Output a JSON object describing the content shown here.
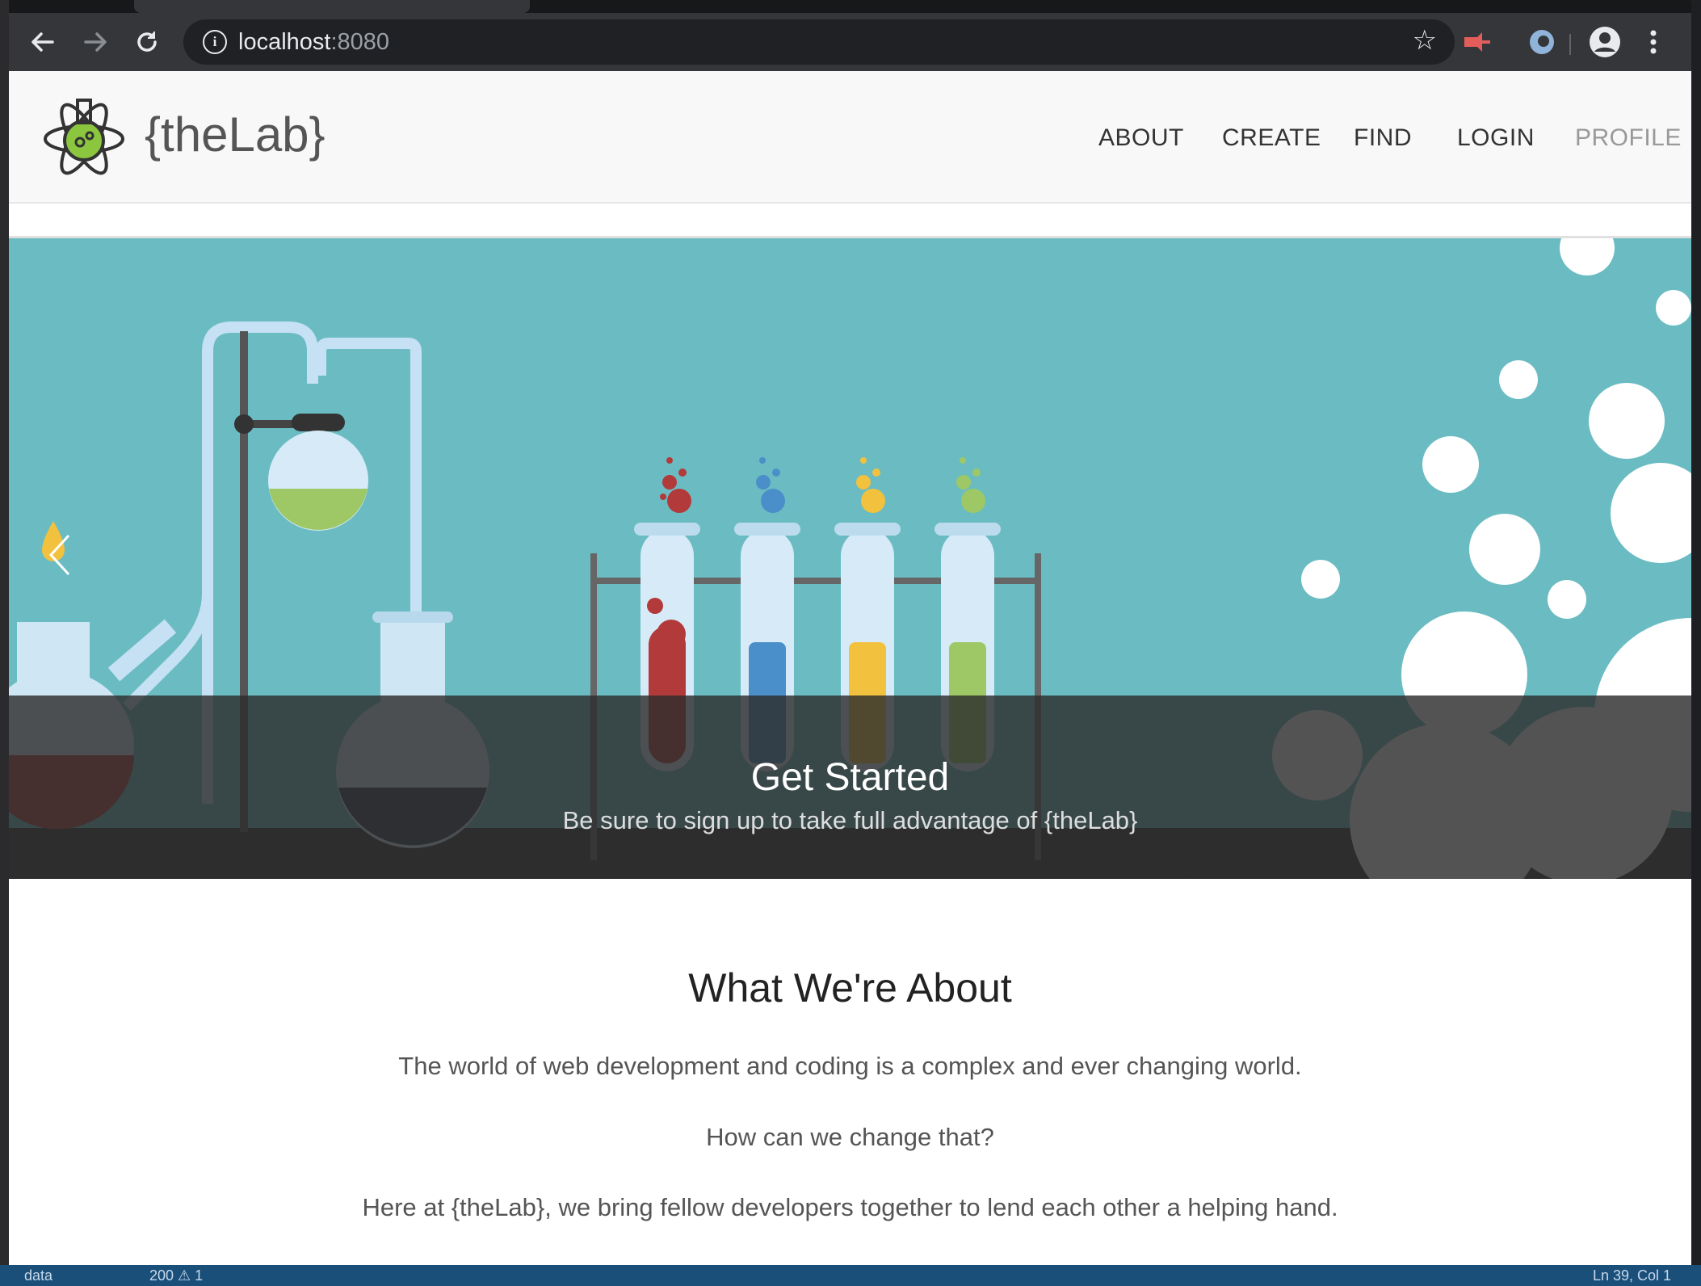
{
  "browser": {
    "host": "localhost",
    "port": ":8080",
    "icons": {
      "back": "arrow-left-icon",
      "forward": "arrow-right-icon",
      "reload": "reload-icon",
      "info": "info-icon",
      "star": "star-icon",
      "menu": "kebab-menu-icon"
    }
  },
  "site": {
    "brand": "{theLab}",
    "nav": [
      "ABOUT",
      "CREATE",
      "FIND",
      "LOGIN",
      "PROFILE"
    ]
  },
  "hero": {
    "title": "Get Started",
    "subtitle": "Be sure to sign up to take full advantage of {theLab}"
  },
  "about": {
    "title": "What We're About",
    "paragraphs": [
      "The world of web development and coding is a complex and ever changing world.",
      "How can we change that?",
      "Here at {theLab}, we bring fellow developers together to lend each other a helping hand."
    ]
  },
  "statusbar": {
    "branch": "data",
    "counts": "200 ⚠ 1",
    "position": "Ln 39, Col 1"
  },
  "colors": {
    "hero_bg": "#6abcc2",
    "red": "#b33a3a",
    "blue": "#4a8fc9",
    "yellow": "#f2c13e",
    "green": "#9dc865"
  }
}
